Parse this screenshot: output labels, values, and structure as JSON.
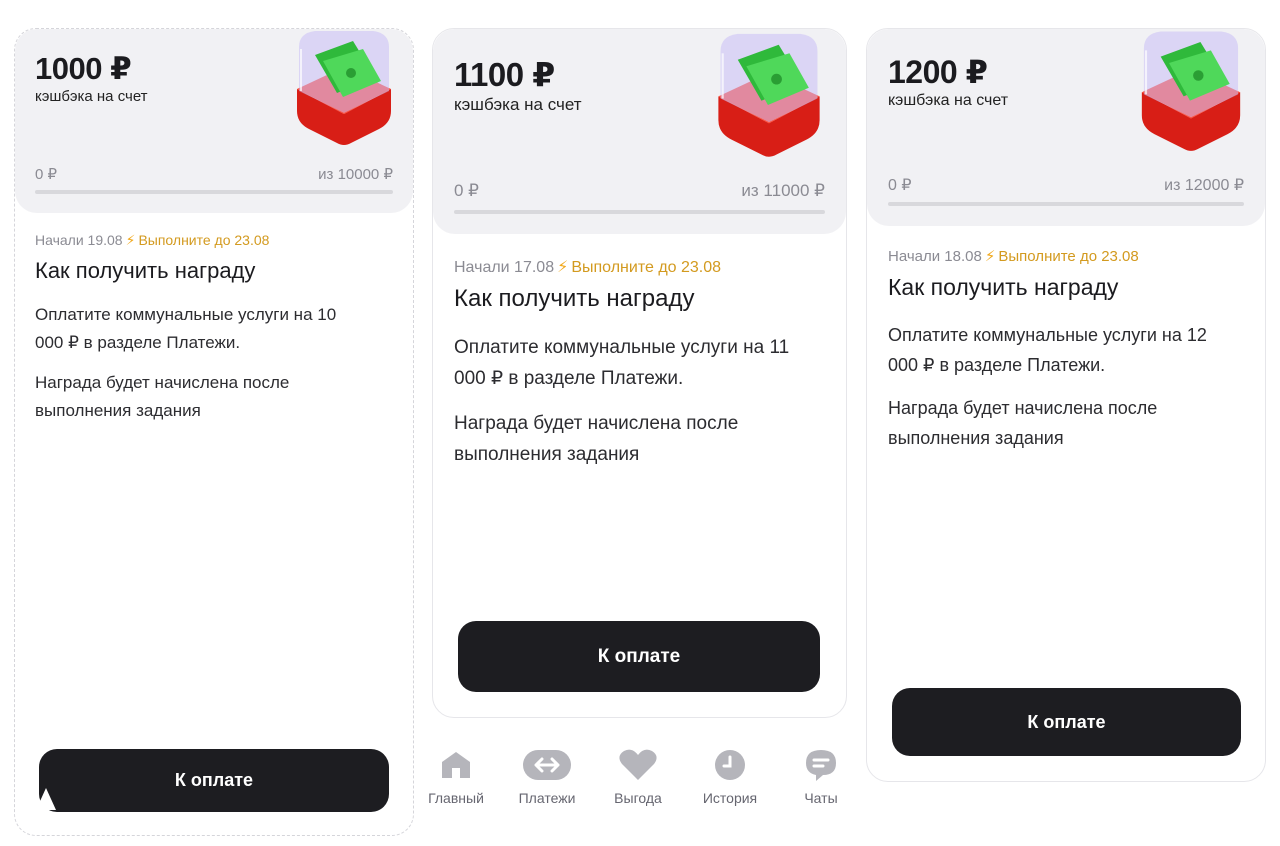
{
  "cards": [
    {
      "amount": "1000 ₽",
      "subtitle": "кэшбэка на счет",
      "progress_current": "0 ₽",
      "progress_target": "из 10000 ₽",
      "progress_fraction": 0,
      "started": "Начали 19.08",
      "deadline": "Выполните до 23.08",
      "heading": "Как получить награду",
      "instruction": "Оплатите коммунальные услуги на 10 000 ₽ в разделе Платежи.",
      "reward_note": "Награда будет начислена после выполнения задания",
      "button_label": "К оплате"
    },
    {
      "amount": "1100 ₽",
      "subtitle": "кэшбэка на счет",
      "progress_current": "0 ₽",
      "progress_target": "из 11000 ₽",
      "progress_fraction": 0,
      "started": "Начали 17.08",
      "deadline": "Выполните до 23.08",
      "heading": "Как получить награду",
      "instruction": "Оплатите коммунальные услуги на 11 000 ₽ в разделе Платежи.",
      "reward_note": "Награда будет начислена после выполнения задания",
      "button_label": "К оплате"
    },
    {
      "amount": "1200 ₽",
      "subtitle": "кэшбэка на счет",
      "progress_current": "0 ₽",
      "progress_target": "из 12000 ₽",
      "progress_fraction": 0,
      "started": "Начали 18.08",
      "deadline": "Выполните до 23.08",
      "heading": "Как получить награду",
      "instruction": "Оплатите коммунальные услуги на 12 000 ₽ в разделе Платежи.",
      "reward_note": "Награда будет начислена после выполнения задания",
      "button_label": "К оплате"
    }
  ],
  "bottom_nav": [
    {
      "label": "Главный",
      "icon": "home-icon"
    },
    {
      "label": "Платежи",
      "icon": "transfer-arrows-icon"
    },
    {
      "label": "Выгода",
      "icon": "heart-icon"
    },
    {
      "label": "История",
      "icon": "clock-icon"
    },
    {
      "label": "Чаты",
      "icon": "chat-bubble-icon"
    }
  ],
  "colors": {
    "button": "#1d1d21",
    "deadline": "#d39a1f",
    "hero_background": "#f1f1f4",
    "nav_icon": "#b5b5bb",
    "cube_red": "#ef2b1f",
    "cash_green": "#3fc94a"
  }
}
